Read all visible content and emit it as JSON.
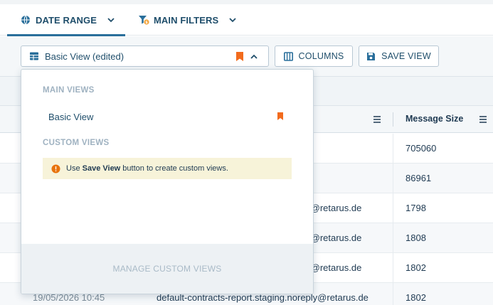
{
  "filters": {
    "date_range": "DATE RANGE",
    "main_filters": "MAIN FILTERS"
  },
  "toolbar": {
    "view_select_label": "Basic View (edited)",
    "columns_label": "COLUMNS",
    "save_view_label": "SAVE VIEW"
  },
  "table": {
    "headers": [
      "",
      "Message Size"
    ],
    "rows": [
      {
        "date": "",
        "sender": "",
        "size": "705060"
      },
      {
        "date": "",
        "sender": "",
        "size": "86961"
      },
      {
        "date": "",
        "sender": "ply@retarus.de",
        "size": "1798"
      },
      {
        "date": "",
        "sender": "ply@retarus.de",
        "size": "1808"
      },
      {
        "date": "",
        "sender": "ply@retarus.de",
        "size": "1802"
      },
      {
        "date": "19/05/2026 10:45",
        "sender": "default-contracts-report.staging.noreply@retarus.de",
        "size": "1802"
      }
    ]
  },
  "dropdown": {
    "main_views_heading": "MAIN VIEWS",
    "main_views": [
      "Basic View"
    ],
    "custom_views_heading": "CUSTOM VIEWS",
    "notice": {
      "prefix": "Use ",
      "emphasis": "Save View",
      "suffix": " button to create custom views."
    },
    "manage_label": "MANAGE CUSTOM VIEWS"
  },
  "colors": {
    "accent": "#2a6f9b",
    "bookmark": "#f26b1d",
    "notice_bg": "#f7f3d9",
    "warning_icon": "#e8730c"
  }
}
